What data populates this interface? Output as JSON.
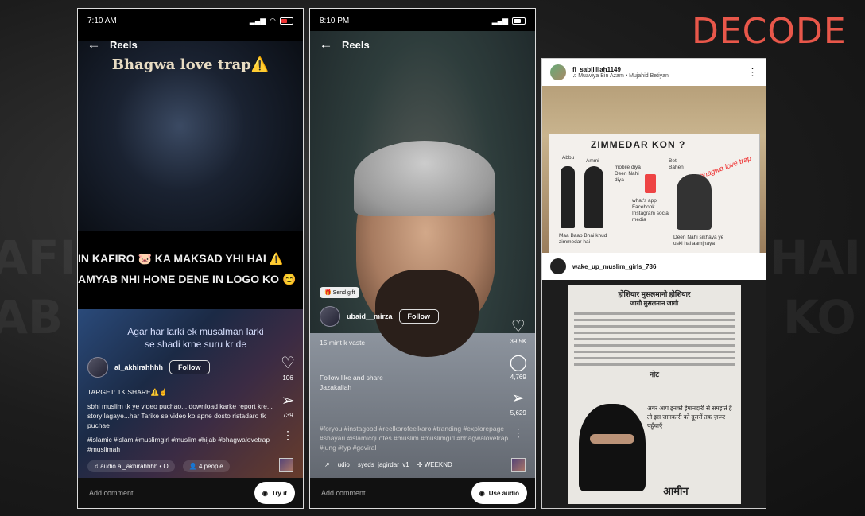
{
  "brand": {
    "logo_text": "DECODE",
    "color": "#e8574a"
  },
  "background": {
    "left_text": "AFIRO",
    "left_text2": "AB NH",
    "right_text": "HAI",
    "right_text2": "KO"
  },
  "phone1": {
    "status": {
      "time": "7:10 AM",
      "battery": "14"
    },
    "header": {
      "title": "Reels"
    },
    "overlay_title": "Bhagwa love trap⚠️",
    "marquee1": "IN KAFIRO 🐷 KA MAKSAD YHI HAI ⚠️",
    "marquee2": "AMYAB NHI HONE DENE IN LOGO KO 😊",
    "video_caption": "Agar har larki ek musalman larki se shadi krne suru kr de",
    "user": {
      "handle": "al_akhirahhhh",
      "follow": "Follow"
    },
    "caption": [
      "TARGET: 1K SHARE⚠️☝️",
      "sbhi muslim tk ye video puchao... download karke report kre... story lagaye...har Tarike se video ko apne dosto ristadaro tk puchae",
      "#islamic #islam #muslimgirl #muslim #hijab #bhagwalovetrap #muslimah"
    ],
    "actions": {
      "likes": "106",
      "shares": "739"
    },
    "audio": {
      "label": "audio",
      "source": "al_akhirahhhh • O",
      "people": "4 people"
    },
    "comment_placeholder": "Add comment...",
    "camera_label": "Try it"
  },
  "phone2": {
    "status": {
      "time": "8:10 PM"
    },
    "header": {
      "title": "Reels"
    },
    "gift": "Send gift",
    "user": {
      "handle": "ubaid__mirza",
      "follow": "Follow"
    },
    "caption": [
      "15 mint k vaste",
      "Follow like and share",
      "Jazakallah",
      "#foryou #instagood #reelkarofeelkaro #tranding #explorepage #shayari #islamicquotes #muslim #muslimgirl #bhagwalovetrap #jung #fyp #goviral"
    ],
    "actions": {
      "likes": "39.5K",
      "comments": "4,769",
      "shares": "5,629"
    },
    "audio": {
      "label": "udio",
      "source": "syeds_jagirdar_v1",
      "extra": "WEEKND"
    },
    "comment_placeholder": "Add comment...",
    "camera_label": "Use audio"
  },
  "post1": {
    "handle": "fi_sabilillah1149",
    "audio": "Muaviya Bin Azam • Mujahid Betiyan",
    "banner_title": "ZIMMEDAR KON ?",
    "labels": {
      "abbu": "Abbu",
      "ammi": "Ammi",
      "beti": "Beti Bahen",
      "middle": "mobile diya Deen Nahi diya",
      "apps": "what's app Facebook Instagram social media",
      "parents": "Maa Baap Bhai khud zimmedar hai",
      "deen": "Deen Nahi sikhaya ye uski hai aamjhaya"
    },
    "red_tag": "bhagwa love trap"
  },
  "post2": {
    "handle": "wake_up_muslim_girls_786",
    "notice_title": "होशियार मुसलमानो होशियार",
    "notice_sub": "जागो मुसलमान जागो",
    "note": "नोट",
    "body": "अगर आप इनको ईमानदारी से समझते हैं तो इस जानकारी को दूसरों तक ज़रूर पहुँचाएँ",
    "amen": "आमीन"
  }
}
